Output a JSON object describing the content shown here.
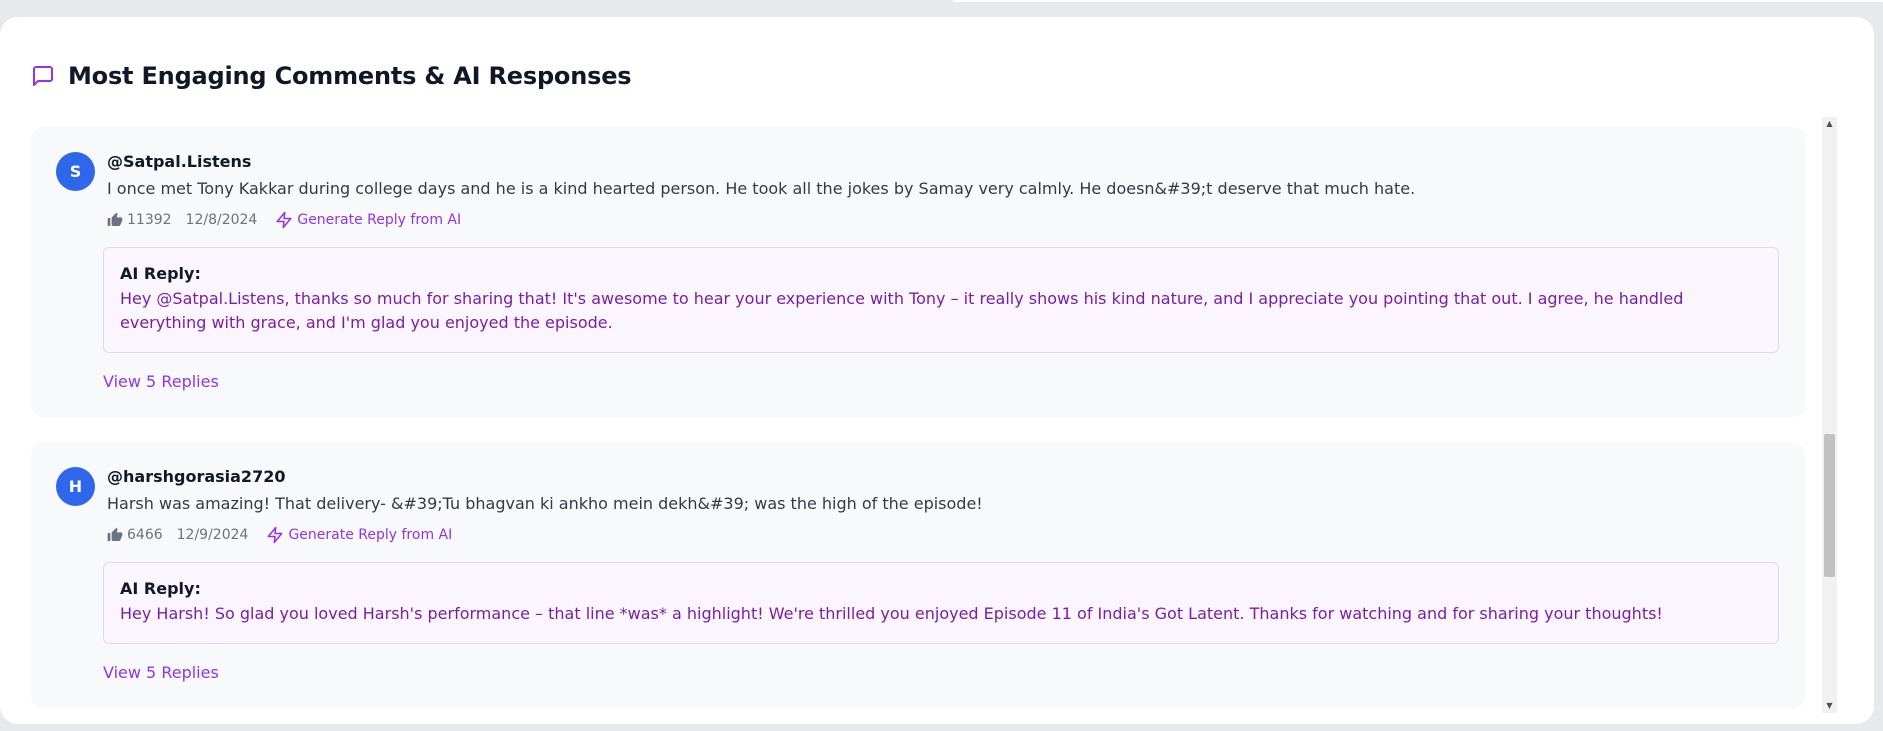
{
  "panel": {
    "title": "Most Engaging Comments & AI Responses",
    "icon": "message-square-icon",
    "accent": "#9333ea"
  },
  "comments": [
    {
      "avatar_initial": "S",
      "author": "@Satpal.Listens",
      "text": "I once met Tony Kakkar during college days and he is a kind hearted person. He took all the jokes by Samay very calmly. He doesn&#39;t deserve that much hate.",
      "likes": "11392",
      "date": "12/8/2024",
      "generate_label": "Generate Reply from AI",
      "ai_label": "AI Reply:",
      "ai_reply": "Hey @Satpal.Listens, thanks so much for sharing that! It's awesome to hear your experience with Tony – it really shows his kind nature, and I appreciate you pointing that out. I agree, he handled everything with grace, and I'm glad you enjoyed the episode.",
      "view_replies": "View 5 Replies"
    },
    {
      "avatar_initial": "H",
      "author": "@harshgorasia2720",
      "text": "Harsh was amazing! That delivery- &#39;Tu bhagvan ki ankho mein dekh&#39; was the high of the episode!",
      "likes": "6466",
      "date": "12/9/2024",
      "generate_label": "Generate Reply from AI",
      "ai_label": "AI Reply:",
      "ai_reply": "Hey Harsh! So glad you loved Harsh's performance – that line *was* a highlight! We're thrilled you enjoyed Episode 11 of India's Got Latent. Thanks for watching and for sharing your thoughts!",
      "view_replies": "View 5 Replies"
    }
  ],
  "colors": {
    "avatar_bg": "#2f67ea",
    "ai_text": "#7b1fa2",
    "ai_bg": "#faf5ff"
  },
  "scrollbar": {
    "position_fraction": 0.53
  }
}
